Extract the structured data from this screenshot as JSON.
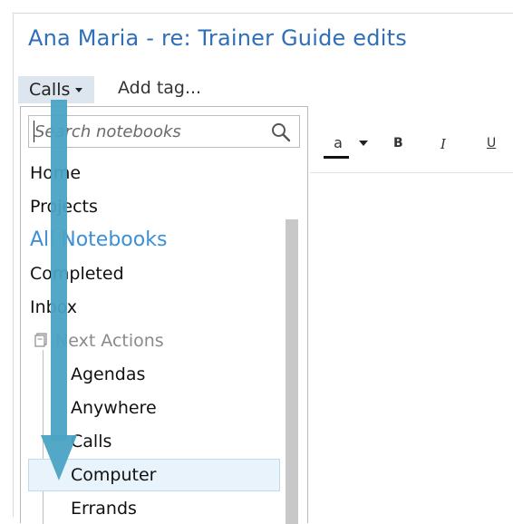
{
  "window": {
    "title": "Ana Maria - re: Trainer Guide edits"
  },
  "tags": {
    "current_tag_label": "Calls",
    "add_tag_label": "Add tag..."
  },
  "toolbar": {
    "font_color_label": "a",
    "bold_label": "B",
    "italic_label": "I",
    "underline_label": "U"
  },
  "dropdown": {
    "search_placeholder": "Search notebooks",
    "items": [
      {
        "label": "Home"
      },
      {
        "label": "Projects"
      },
      {
        "label": "All Notebooks"
      },
      {
        "label": "Completed"
      },
      {
        "label": "Inbox"
      },
      {
        "label": "Next Actions"
      }
    ],
    "children": [
      {
        "label": "Agendas"
      },
      {
        "label": "Anywhere"
      },
      {
        "label": "Calls"
      },
      {
        "label": "Computer"
      },
      {
        "label": "Errands"
      }
    ],
    "selected": "Computer"
  },
  "colors": {
    "title": "#2e6fb7",
    "accent": "#3d8fd6",
    "arrow": "#4ba3c4",
    "selection_bg": "#e9f3fb",
    "tag_button_bg": "#dde6ef"
  },
  "icons": {
    "search": "search-icon",
    "notebook_stack": "notebook-stack-icon",
    "dropdown_caret": "chevron-down-icon",
    "overlay_arrow": "down-arrow-annotation-icon"
  }
}
